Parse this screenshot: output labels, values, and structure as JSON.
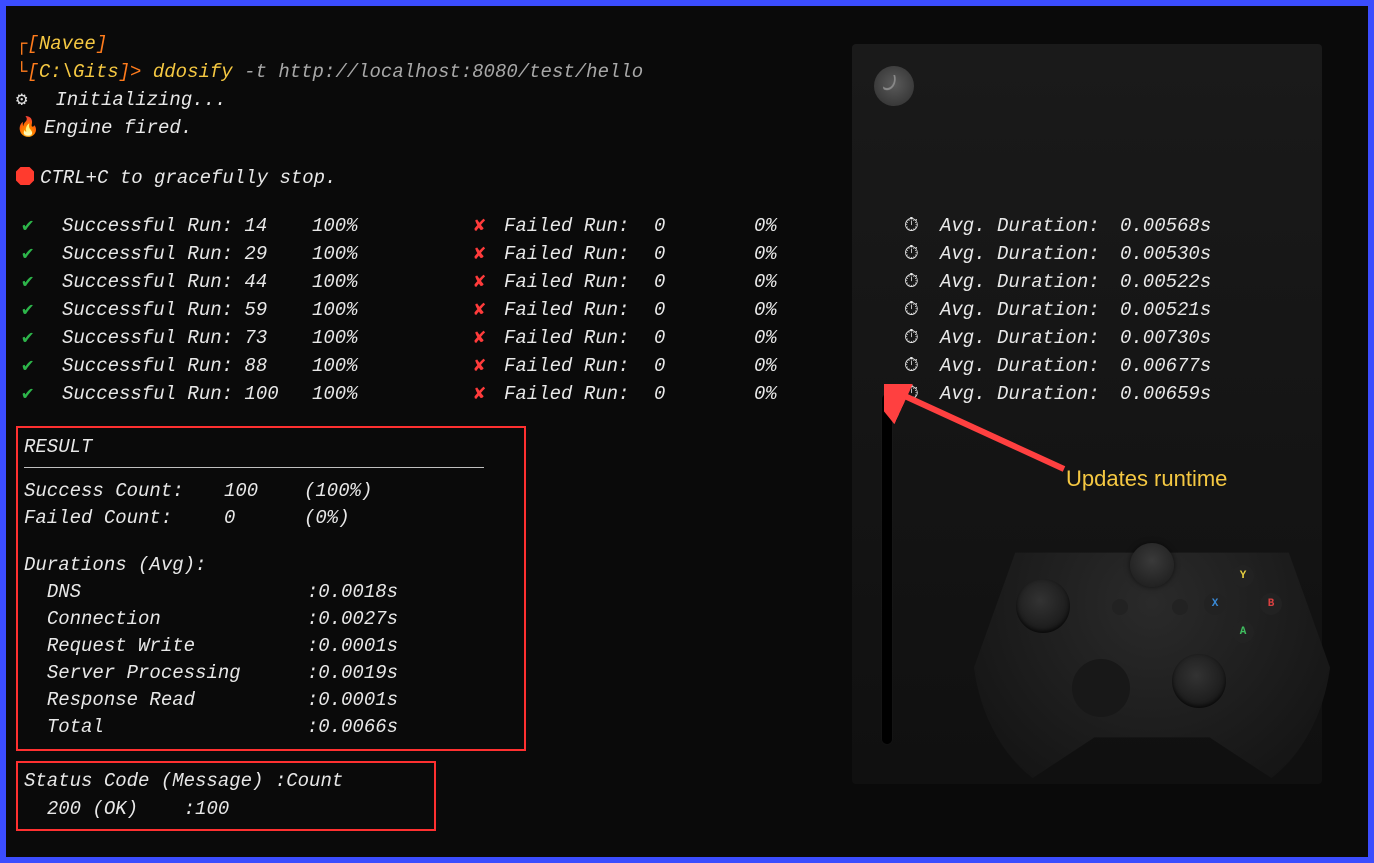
{
  "prompt": {
    "user": "Navee",
    "path": "C:\\Gits",
    "sep": ">",
    "command": "ddosify",
    "flag": "-t",
    "url": "http://localhost:8080/test/hello"
  },
  "init": {
    "line1": "Initializing...",
    "line2": "Engine fired."
  },
  "stop_hint": "CTRL+C to gracefully stop.",
  "run_labels": {
    "success": "Successful Run:",
    "failed": "Failed Run:",
    "duration": "Avg. Duration:"
  },
  "runs": [
    {
      "s": "14",
      "sp": "100%",
      "f": "0",
      "fp": "0%",
      "d": "0.00568s"
    },
    {
      "s": "29",
      "sp": "100%",
      "f": "0",
      "fp": "0%",
      "d": "0.00530s"
    },
    {
      "s": "44",
      "sp": "100%",
      "f": "0",
      "fp": "0%",
      "d": "0.00522s"
    },
    {
      "s": "59",
      "sp": "100%",
      "f": "0",
      "fp": "0%",
      "d": "0.00521s"
    },
    {
      "s": "73",
      "sp": "100%",
      "f": "0",
      "fp": "0%",
      "d": "0.00730s"
    },
    {
      "s": "88",
      "sp": "100%",
      "f": "0",
      "fp": "0%",
      "d": "0.00677s"
    },
    {
      "s": "100",
      "sp": "100%",
      "f": "0",
      "fp": "0%",
      "d": "0.00659s"
    }
  ],
  "result": {
    "header": "RESULT",
    "success_label": "Success Count:",
    "success_count": "100",
    "success_pct": "(100%)",
    "failed_label": "Failed Count:",
    "failed_count": "0",
    "failed_pct": "(0%)",
    "durations_header": "Durations (Avg):",
    "rows": [
      {
        "label": "DNS",
        "value": ":0.0018s"
      },
      {
        "label": "Connection",
        "value": ":0.0027s"
      },
      {
        "label": "Request Write",
        "value": ":0.0001s"
      },
      {
        "label": "Server Processing",
        "value": ":0.0019s"
      },
      {
        "label": "Response Read",
        "value": ":0.0001s"
      },
      {
        "label": "Total",
        "value": ":0.0066s"
      }
    ]
  },
  "status": {
    "header": "Status Code (Message) :Count",
    "line": "200 (OK)    :100"
  },
  "annotation": "Updates runtime",
  "icons": {
    "gear": "⚙",
    "fire": "🔥",
    "clock": "⏱",
    "check": "✔",
    "cross": "✘",
    "face_y": "Y",
    "face_x": "X",
    "face_b": "B",
    "face_a": "A"
  }
}
